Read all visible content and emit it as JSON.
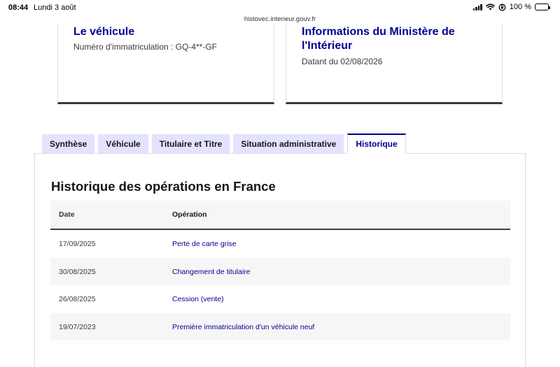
{
  "status_bar": {
    "time": "08:44",
    "date": "Lundi 3 août",
    "wifi_icon": "wifi-icon",
    "lock_icon": "orientation-lock-icon",
    "battery_percent": "100 %",
    "url": "histovec.interieur.gouv.fr"
  },
  "cards": {
    "vehicle": {
      "title": "Le véhicule",
      "description": "Numéro d'immatriculation : GQ-4**-GF"
    },
    "ministry": {
      "title": "Informations du Ministère de l'Intérieur",
      "description": "Datant du 02/08/2026"
    }
  },
  "tabs": [
    {
      "label": "Synthèse",
      "active": false
    },
    {
      "label": "Véhicule",
      "active": false
    },
    {
      "label": "Titulaire et Titre",
      "active": false
    },
    {
      "label": "Situation administrative",
      "active": false
    },
    {
      "label": "Historique",
      "active": true
    }
  ],
  "history": {
    "title": "Historique des opérations en France",
    "columns": {
      "date": "Date",
      "operation": "Opération"
    },
    "rows": [
      {
        "date": "17/09/2025",
        "operation": "Perte de carte grise"
      },
      {
        "date": "30/08/2025",
        "operation": "Changement de titulaire"
      },
      {
        "date": "26/08/2025",
        "operation": "Cession (vente)"
      },
      {
        "date": "19/07/2023",
        "operation": "Première immatriculation d'un véhicule neuf"
      }
    ]
  },
  "colors": {
    "primary_blue": "#000091",
    "tab_background": "#e3e3fd",
    "row_stripe": "#f6f6f6"
  }
}
